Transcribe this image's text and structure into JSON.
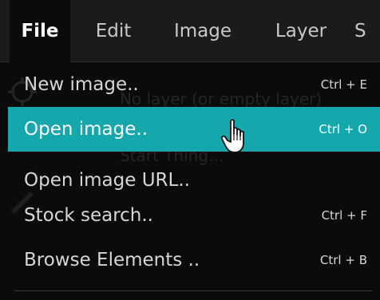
{
  "menubar": {
    "items": [
      {
        "label": "File",
        "active": true
      },
      {
        "label": "Edit"
      },
      {
        "label": "Image"
      },
      {
        "label": "Layer"
      },
      {
        "label": "S"
      }
    ]
  },
  "file_menu": {
    "items": [
      {
        "label": "New image..",
        "shortcut": "Ctrl + E"
      },
      {
        "label": "Open image..",
        "shortcut": "Ctrl + O",
        "highlighted": true
      },
      {
        "label": "Open image URL..",
        "shortcut": ""
      },
      {
        "label": "Stock search..",
        "shortcut": "Ctrl + F"
      },
      {
        "label": "Browse Elements ..",
        "shortcut": "Ctrl + B"
      }
    ]
  },
  "background": {
    "ghost_lines": [
      "No layer (or empty layer)",
      "Start  Thing..."
    ]
  },
  "colors": {
    "menubar_bg": "#1b1b1b",
    "menu_bg": "#0b0b0b",
    "highlight": "#14a7ac",
    "text": "#d6d6d6"
  },
  "icons": {
    "cursor": "hand-pointer-icon"
  }
}
